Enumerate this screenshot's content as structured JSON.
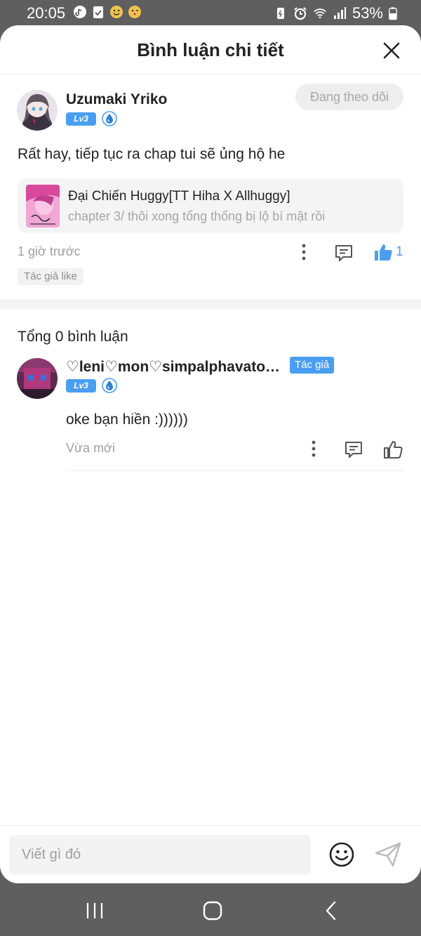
{
  "status_bar": {
    "time": "20:05",
    "battery": "53%",
    "icons": [
      "tiktok-icon",
      "clipboard-check-icon",
      "emoji-icon",
      "emoji-kiss-icon",
      "battery-saver-icon",
      "alarm-icon",
      "wifi-icon",
      "signal-icon",
      "battery-icon"
    ]
  },
  "header": {
    "title": "Bình luận chi tiết",
    "close_icon": "close-icon"
  },
  "main_comment": {
    "username": "Uzumaki Yriko",
    "level": "Lv3",
    "follow_label": "Đang theo dõi",
    "text": "Rất hay, tiếp tục ra chap tui sẽ ủng hộ he",
    "chapter_card": {
      "title": "Đại Chiến Huggy[TT Hiha X Allhuggy]",
      "subtitle": "chapter 3/ thôi xong tổng thống bị lộ bí mật rồi"
    },
    "time": "1 giờ trước",
    "like_count": "1",
    "author_like_tag": "Tác giả like"
  },
  "replies_section": {
    "total_label": "Tổng 0 bình luận",
    "replies": [
      {
        "username": "♡leni♡mon♡simpalphavatong...",
        "author_tag": "Tác giả",
        "level": "Lv3",
        "text": "oke bạn hiền :))))))",
        "time": "Vừa mới"
      }
    ]
  },
  "input_bar": {
    "placeholder": "Viết gì đó",
    "value": ""
  },
  "colors": {
    "accent": "#4a9ef0",
    "muted_text": "#9e9e9e",
    "system_bar": "#5f5f5f"
  }
}
